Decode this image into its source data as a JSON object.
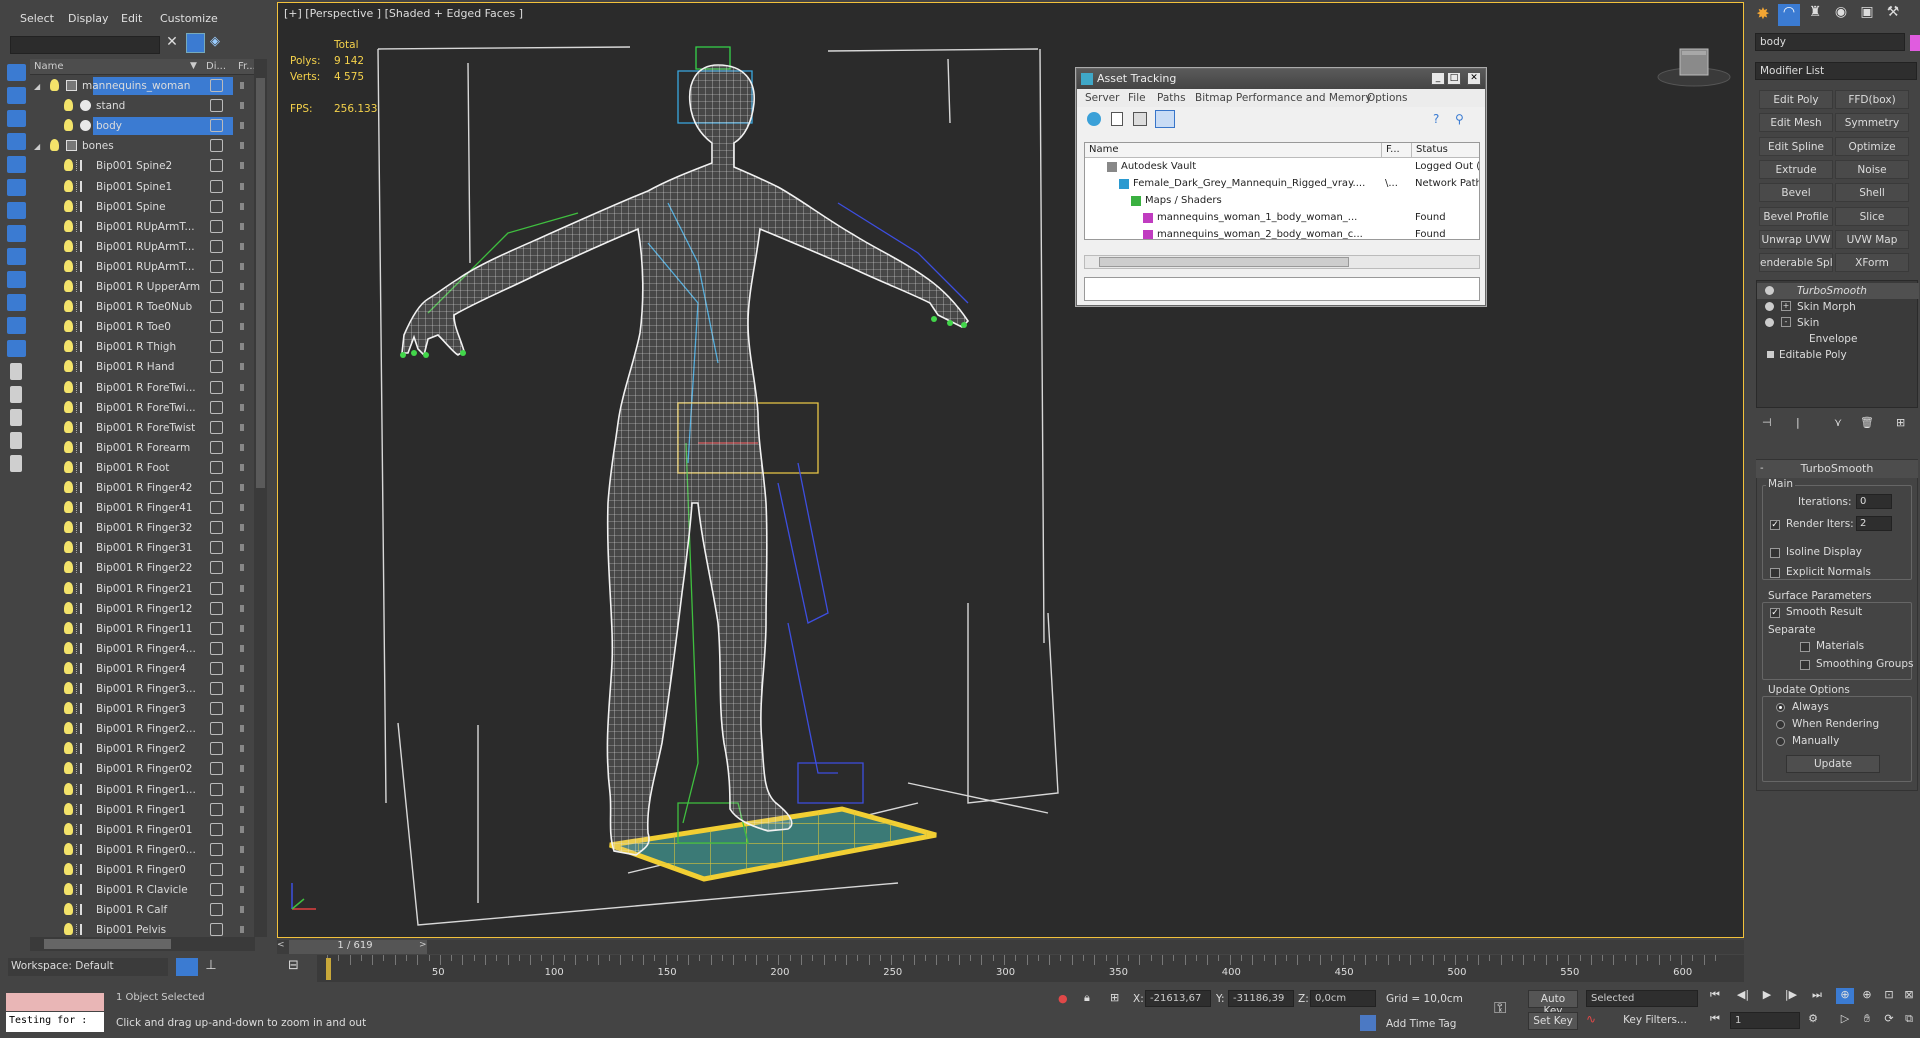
{
  "menu": [
    "Select",
    "Display",
    "Edit",
    "Customize"
  ],
  "explorer": {
    "col_name": "Name",
    "col_di": "Di...",
    "col_fr": "Fr...",
    "rows": [
      {
        "label": "mannequins_woman",
        "level": 0,
        "type": "layer",
        "expanded": true,
        "selected": true
      },
      {
        "label": "stand",
        "level": 1,
        "type": "object"
      },
      {
        "label": "body",
        "level": 1,
        "type": "object",
        "selected": true
      },
      {
        "label": "bones",
        "level": 0,
        "type": "layer",
        "expanded": true
      },
      {
        "label": "Bip001 Spine2",
        "level": 1,
        "type": "bone"
      },
      {
        "label": "Bip001 Spine1",
        "level": 1,
        "type": "bone"
      },
      {
        "label": "Bip001 Spine",
        "level": 1,
        "type": "bone"
      },
      {
        "label": "Bip001 RUpArmT...",
        "level": 1,
        "type": "bone"
      },
      {
        "label": "Bip001 RUpArmT...",
        "level": 1,
        "type": "bone"
      },
      {
        "label": "Bip001 RUpArmT...",
        "level": 1,
        "type": "bone"
      },
      {
        "label": "Bip001 R UpperArm",
        "level": 1,
        "type": "bone"
      },
      {
        "label": "Bip001 R Toe0Nub",
        "level": 1,
        "type": "bone"
      },
      {
        "label": "Bip001 R Toe0",
        "level": 1,
        "type": "bone"
      },
      {
        "label": "Bip001 R Thigh",
        "level": 1,
        "type": "bone"
      },
      {
        "label": "Bip001 R Hand",
        "level": 1,
        "type": "bone"
      },
      {
        "label": "Bip001 R ForeTwi...",
        "level": 1,
        "type": "bone"
      },
      {
        "label": "Bip001 R ForeTwi...",
        "level": 1,
        "type": "bone"
      },
      {
        "label": "Bip001 R ForeTwist",
        "level": 1,
        "type": "bone"
      },
      {
        "label": "Bip001 R Forearm",
        "level": 1,
        "type": "bone"
      },
      {
        "label": "Bip001 R Foot",
        "level": 1,
        "type": "bone"
      },
      {
        "label": "Bip001 R Finger42",
        "level": 1,
        "type": "bone"
      },
      {
        "label": "Bip001 R Finger41",
        "level": 1,
        "type": "bone"
      },
      {
        "label": "Bip001 R Finger32",
        "level": 1,
        "type": "bone"
      },
      {
        "label": "Bip001 R Finger31",
        "level": 1,
        "type": "bone"
      },
      {
        "label": "Bip001 R Finger22",
        "level": 1,
        "type": "bone"
      },
      {
        "label": "Bip001 R Finger21",
        "level": 1,
        "type": "bone"
      },
      {
        "label": "Bip001 R Finger12",
        "level": 1,
        "type": "bone"
      },
      {
        "label": "Bip001 R Finger11",
        "level": 1,
        "type": "bone"
      },
      {
        "label": "Bip001 R Finger4...",
        "level": 1,
        "type": "bone"
      },
      {
        "label": "Bip001 R Finger4",
        "level": 1,
        "type": "bone"
      },
      {
        "label": "Bip001 R Finger3...",
        "level": 1,
        "type": "bone"
      },
      {
        "label": "Bip001 R Finger3",
        "level": 1,
        "type": "bone"
      },
      {
        "label": "Bip001 R Finger2...",
        "level": 1,
        "type": "bone"
      },
      {
        "label": "Bip001 R Finger2",
        "level": 1,
        "type": "bone"
      },
      {
        "label": "Bip001 R Finger02",
        "level": 1,
        "type": "bone"
      },
      {
        "label": "Bip001 R Finger1...",
        "level": 1,
        "type": "bone"
      },
      {
        "label": "Bip001 R Finger1",
        "level": 1,
        "type": "bone"
      },
      {
        "label": "Bip001 R Finger01",
        "level": 1,
        "type": "bone"
      },
      {
        "label": "Bip001 R Finger0...",
        "level": 1,
        "type": "bone"
      },
      {
        "label": "Bip001 R Finger0",
        "level": 1,
        "type": "bone"
      },
      {
        "label": "Bip001 R Clavicle",
        "level": 1,
        "type": "bone"
      },
      {
        "label": "Bip001 R Calf",
        "level": 1,
        "type": "bone"
      },
      {
        "label": "Bip001 Pelvis",
        "level": 1,
        "type": "bone"
      }
    ]
  },
  "workspace": "Workspace: Default",
  "viewport": {
    "label": "[+] [Perspective ] [Shaded + Edged Faces ]",
    "stats_header": "Total",
    "polys_label": "Polys:",
    "polys_value": "9 142",
    "verts_label": "Verts:",
    "verts_value": "4 575",
    "fps_label": "FPS:",
    "fps_value": "256.133"
  },
  "timeline": {
    "slider_label": "1 / 619",
    "ticks": [
      50,
      100,
      150,
      200,
      250,
      300,
      350,
      400,
      450,
      500,
      550,
      600
    ]
  },
  "asset_tracking": {
    "title": "Asset Tracking",
    "menu": [
      "Server",
      "File",
      "Paths",
      "Bitmap Performance and Memory",
      "Options"
    ],
    "columns": [
      "Name",
      "F...",
      "Status"
    ],
    "rows": [
      {
        "name": "Autodesk Vault",
        "f": "",
        "status": "Logged Out (",
        "indent": 1
      },
      {
        "name": "Female_Dark_Grey_Mannequin_Rigged_vray....",
        "f": "\\...",
        "status": "Network Path",
        "indent": 2
      },
      {
        "name": "Maps / Shaders",
        "f": "",
        "status": "",
        "indent": 3
      },
      {
        "name": "mannequins_woman_1_body_woman_...",
        "f": "",
        "status": "Found",
        "indent": 4
      },
      {
        "name": "mannequins_woman_2_body_woman_c...",
        "f": "",
        "status": "Found",
        "indent": 4
      }
    ]
  },
  "command_panel": {
    "object_name": "body",
    "object_color": "#e05cdf",
    "modifier_list": "Modifier List",
    "buttons": [
      "Edit Poly",
      "FFD(box)",
      "Edit Mesh",
      "Symmetry",
      "Edit Spline",
      "Optimize",
      "Extrude",
      "Noise",
      "Bevel",
      "Shell",
      "Bevel Profile",
      "Slice",
      "Unwrap UVW",
      "UVW Map",
      "enderable Splin",
      "XForm"
    ],
    "stack": [
      {
        "label": "TurboSmooth",
        "italic": true,
        "indent": 0
      },
      {
        "label": "Skin Morph",
        "indent": 0
      },
      {
        "label": "Skin",
        "indent": 0,
        "expand": "-"
      },
      {
        "label": "Envelope",
        "indent": 1
      },
      {
        "label": "Editable Poly",
        "indent": 0
      }
    ],
    "turbosmooth": {
      "title": "TurboSmooth",
      "main": "Main",
      "iterations_label": "Iterations:",
      "iterations_value": "0",
      "render_iters_label": "Render Iters:",
      "render_iters_value": "2",
      "isoline": "Isoline Display",
      "explicit": "Explicit Normals",
      "surface": "Surface Parameters",
      "smooth_result": "Smooth Result",
      "separate": "Separate",
      "materials": "Materials",
      "smoothing_groups": "Smoothing Groups",
      "update_options": "Update Options",
      "always": "Always",
      "when_rendering": "When Rendering",
      "manually": "Manually",
      "update": "Update"
    }
  },
  "statusbar": {
    "selected": "1 Object Selected",
    "prompt": "Click and drag up-and-down to zoom in and out",
    "maxscript": "Testing for :",
    "x_label": "X:",
    "x_value": "-21613,67",
    "y_label": "Y:",
    "y_value": "-31186,39",
    "z_label": "Z:",
    "z_value": "0,0cm",
    "grid": "Grid = 10,0cm",
    "add_time_tag": "Add Time Tag",
    "auto_key": "Auto Key",
    "set_key": "Set Key",
    "selected_dropdown": "Selected",
    "key_filters": "Key Filters...",
    "frame": "1"
  }
}
